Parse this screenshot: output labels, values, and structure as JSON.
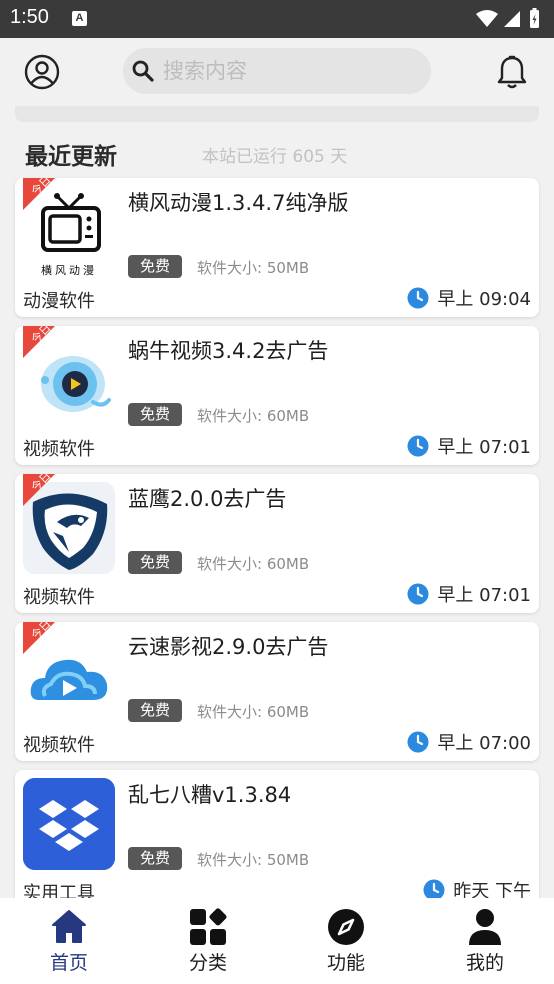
{
  "status_bar": {
    "time": "1:50",
    "notification_letter": "A"
  },
  "search": {
    "placeholder": "搜索内容"
  },
  "section": {
    "title": "最近更新",
    "meta": "本站已运行 605 天"
  },
  "ribbon_text": "今日",
  "thumb_caption_1": "横风动漫",
  "cards": [
    {
      "title": "横风动漫1.3.4.7纯净版",
      "badge": "免费",
      "size": "软件大小: 50MB",
      "category": "动漫软件",
      "time": "早上 09:04",
      "icon": "tv-icon"
    },
    {
      "title": "蜗牛视频3.4.2去广告",
      "badge": "免费",
      "size": "软件大小: 60MB",
      "category": "视频软件",
      "time": "早上 07:01",
      "icon": "snail-video-icon"
    },
    {
      "title": "蓝鹰2.0.0去广告",
      "badge": "免费",
      "size": "软件大小: 60MB",
      "category": "视频软件",
      "time": "早上 07:01",
      "icon": "eagle-icon"
    },
    {
      "title": "云速影视2.9.0去广告",
      "badge": "免费",
      "size": "软件大小: 60MB",
      "category": "视频软件",
      "time": "早上 07:00",
      "icon": "cloud-play-icon"
    },
    {
      "title": "乱七八糟v1.3.84",
      "badge": "免费",
      "size": "软件大小: 50MB",
      "category": "实用工具",
      "time": "昨天 下午",
      "icon": "dropbox-icon"
    }
  ],
  "nav": [
    {
      "label": "首页",
      "icon": "home-icon",
      "active": true
    },
    {
      "label": "分类",
      "icon": "grid-icon",
      "active": false
    },
    {
      "label": "功能",
      "icon": "compass-icon",
      "active": false
    },
    {
      "label": "我的",
      "icon": "person-icon",
      "active": false
    }
  ],
  "colors": {
    "accent": "#263880",
    "clock": "#2b8ae0",
    "ribbon": "#e8473b",
    "badge": "#575757"
  }
}
